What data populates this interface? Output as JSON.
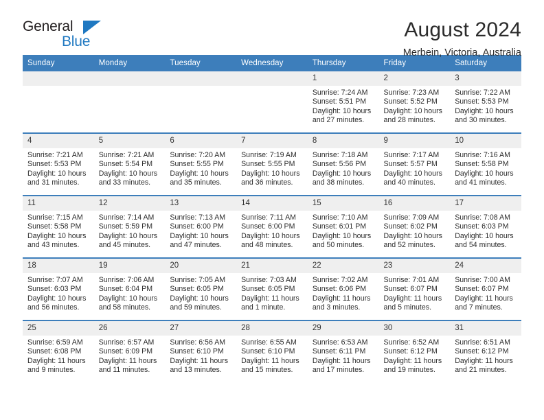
{
  "brand": {
    "name_top": "General",
    "name_bottom": "Blue",
    "accent_color": "#1f78c1"
  },
  "header": {
    "title": "August 2024",
    "subtitle": "Merbein, Victoria, Australia"
  },
  "theme": {
    "header_bg": "#3d7ebb",
    "daynum_bg": "#efefef",
    "text_color": "#2d2d2d"
  },
  "calendar": {
    "weekday_headers": [
      "Sunday",
      "Monday",
      "Tuesday",
      "Wednesday",
      "Thursday",
      "Friday",
      "Saturday"
    ],
    "weeks": [
      [
        {
          "day": "",
          "empty": true
        },
        {
          "day": "",
          "empty": true
        },
        {
          "day": "",
          "empty": true
        },
        {
          "day": "",
          "empty": true
        },
        {
          "day": "1",
          "sunrise": "Sunrise: 7:24 AM",
          "sunset": "Sunset: 5:51 PM",
          "daylight_line1": "Daylight: 10 hours",
          "daylight_line2": "and 27 minutes."
        },
        {
          "day": "2",
          "sunrise": "Sunrise: 7:23 AM",
          "sunset": "Sunset: 5:52 PM",
          "daylight_line1": "Daylight: 10 hours",
          "daylight_line2": "and 28 minutes."
        },
        {
          "day": "3",
          "sunrise": "Sunrise: 7:22 AM",
          "sunset": "Sunset: 5:53 PM",
          "daylight_line1": "Daylight: 10 hours",
          "daylight_line2": "and 30 minutes."
        }
      ],
      [
        {
          "day": "4",
          "sunrise": "Sunrise: 7:21 AM",
          "sunset": "Sunset: 5:53 PM",
          "daylight_line1": "Daylight: 10 hours",
          "daylight_line2": "and 31 minutes."
        },
        {
          "day": "5",
          "sunrise": "Sunrise: 7:21 AM",
          "sunset": "Sunset: 5:54 PM",
          "daylight_line1": "Daylight: 10 hours",
          "daylight_line2": "and 33 minutes."
        },
        {
          "day": "6",
          "sunrise": "Sunrise: 7:20 AM",
          "sunset": "Sunset: 5:55 PM",
          "daylight_line1": "Daylight: 10 hours",
          "daylight_line2": "and 35 minutes."
        },
        {
          "day": "7",
          "sunrise": "Sunrise: 7:19 AM",
          "sunset": "Sunset: 5:55 PM",
          "daylight_line1": "Daylight: 10 hours",
          "daylight_line2": "and 36 minutes."
        },
        {
          "day": "8",
          "sunrise": "Sunrise: 7:18 AM",
          "sunset": "Sunset: 5:56 PM",
          "daylight_line1": "Daylight: 10 hours",
          "daylight_line2": "and 38 minutes."
        },
        {
          "day": "9",
          "sunrise": "Sunrise: 7:17 AM",
          "sunset": "Sunset: 5:57 PM",
          "daylight_line1": "Daylight: 10 hours",
          "daylight_line2": "and 40 minutes."
        },
        {
          "day": "10",
          "sunrise": "Sunrise: 7:16 AM",
          "sunset": "Sunset: 5:58 PM",
          "daylight_line1": "Daylight: 10 hours",
          "daylight_line2": "and 41 minutes."
        }
      ],
      [
        {
          "day": "11",
          "sunrise": "Sunrise: 7:15 AM",
          "sunset": "Sunset: 5:58 PM",
          "daylight_line1": "Daylight: 10 hours",
          "daylight_line2": "and 43 minutes."
        },
        {
          "day": "12",
          "sunrise": "Sunrise: 7:14 AM",
          "sunset": "Sunset: 5:59 PM",
          "daylight_line1": "Daylight: 10 hours",
          "daylight_line2": "and 45 minutes."
        },
        {
          "day": "13",
          "sunrise": "Sunrise: 7:13 AM",
          "sunset": "Sunset: 6:00 PM",
          "daylight_line1": "Daylight: 10 hours",
          "daylight_line2": "and 47 minutes."
        },
        {
          "day": "14",
          "sunrise": "Sunrise: 7:11 AM",
          "sunset": "Sunset: 6:00 PM",
          "daylight_line1": "Daylight: 10 hours",
          "daylight_line2": "and 48 minutes."
        },
        {
          "day": "15",
          "sunrise": "Sunrise: 7:10 AM",
          "sunset": "Sunset: 6:01 PM",
          "daylight_line1": "Daylight: 10 hours",
          "daylight_line2": "and 50 minutes."
        },
        {
          "day": "16",
          "sunrise": "Sunrise: 7:09 AM",
          "sunset": "Sunset: 6:02 PM",
          "daylight_line1": "Daylight: 10 hours",
          "daylight_line2": "and 52 minutes."
        },
        {
          "day": "17",
          "sunrise": "Sunrise: 7:08 AM",
          "sunset": "Sunset: 6:03 PM",
          "daylight_line1": "Daylight: 10 hours",
          "daylight_line2": "and 54 minutes."
        }
      ],
      [
        {
          "day": "18",
          "sunrise": "Sunrise: 7:07 AM",
          "sunset": "Sunset: 6:03 PM",
          "daylight_line1": "Daylight: 10 hours",
          "daylight_line2": "and 56 minutes."
        },
        {
          "day": "19",
          "sunrise": "Sunrise: 7:06 AM",
          "sunset": "Sunset: 6:04 PM",
          "daylight_line1": "Daylight: 10 hours",
          "daylight_line2": "and 58 minutes."
        },
        {
          "day": "20",
          "sunrise": "Sunrise: 7:05 AM",
          "sunset": "Sunset: 6:05 PM",
          "daylight_line1": "Daylight: 10 hours",
          "daylight_line2": "and 59 minutes."
        },
        {
          "day": "21",
          "sunrise": "Sunrise: 7:03 AM",
          "sunset": "Sunset: 6:05 PM",
          "daylight_line1": "Daylight: 11 hours",
          "daylight_line2": "and 1 minute."
        },
        {
          "day": "22",
          "sunrise": "Sunrise: 7:02 AM",
          "sunset": "Sunset: 6:06 PM",
          "daylight_line1": "Daylight: 11 hours",
          "daylight_line2": "and 3 minutes."
        },
        {
          "day": "23",
          "sunrise": "Sunrise: 7:01 AM",
          "sunset": "Sunset: 6:07 PM",
          "daylight_line1": "Daylight: 11 hours",
          "daylight_line2": "and 5 minutes."
        },
        {
          "day": "24",
          "sunrise": "Sunrise: 7:00 AM",
          "sunset": "Sunset: 6:07 PM",
          "daylight_line1": "Daylight: 11 hours",
          "daylight_line2": "and 7 minutes."
        }
      ],
      [
        {
          "day": "25",
          "sunrise": "Sunrise: 6:59 AM",
          "sunset": "Sunset: 6:08 PM",
          "daylight_line1": "Daylight: 11 hours",
          "daylight_line2": "and 9 minutes."
        },
        {
          "day": "26",
          "sunrise": "Sunrise: 6:57 AM",
          "sunset": "Sunset: 6:09 PM",
          "daylight_line1": "Daylight: 11 hours",
          "daylight_line2": "and 11 minutes."
        },
        {
          "day": "27",
          "sunrise": "Sunrise: 6:56 AM",
          "sunset": "Sunset: 6:10 PM",
          "daylight_line1": "Daylight: 11 hours",
          "daylight_line2": "and 13 minutes."
        },
        {
          "day": "28",
          "sunrise": "Sunrise: 6:55 AM",
          "sunset": "Sunset: 6:10 PM",
          "daylight_line1": "Daylight: 11 hours",
          "daylight_line2": "and 15 minutes."
        },
        {
          "day": "29",
          "sunrise": "Sunrise: 6:53 AM",
          "sunset": "Sunset: 6:11 PM",
          "daylight_line1": "Daylight: 11 hours",
          "daylight_line2": "and 17 minutes."
        },
        {
          "day": "30",
          "sunrise": "Sunrise: 6:52 AM",
          "sunset": "Sunset: 6:12 PM",
          "daylight_line1": "Daylight: 11 hours",
          "daylight_line2": "and 19 minutes."
        },
        {
          "day": "31",
          "sunrise": "Sunrise: 6:51 AM",
          "sunset": "Sunset: 6:12 PM",
          "daylight_line1": "Daylight: 11 hours",
          "daylight_line2": "and 21 minutes."
        }
      ]
    ]
  }
}
